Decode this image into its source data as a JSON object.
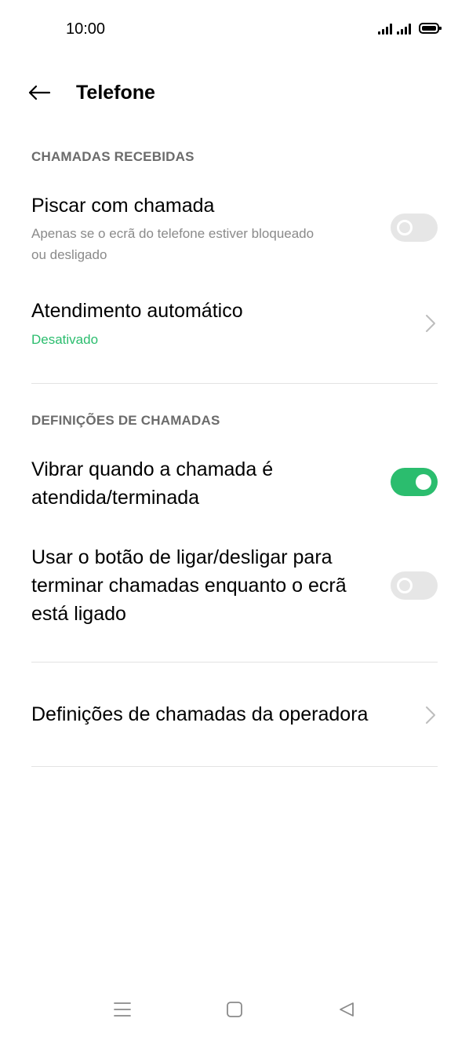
{
  "status_bar": {
    "time": "10:00",
    "signal_icons": [
      "signal-icon",
      "signal-icon"
    ],
    "battery_icon": "battery-icon"
  },
  "header": {
    "back_icon": "arrow-left-icon",
    "title": "Telefone"
  },
  "incoming_section": {
    "header": "CHAMADAS RECEBIDAS",
    "flash": {
      "title": "Piscar com chamada",
      "subtitle_line1": "Apenas se o ecrã do telefone estiver bloqueado",
      "subtitle_line2": "ou desligado",
      "toggle_on": false
    },
    "auto_answer": {
      "title": "Atendimento automático",
      "status": "Desativado",
      "chevron_icon": "chevron-right-icon"
    }
  },
  "call_settings_section": {
    "header": "DEFINIÇÕES DE CHAMADAS",
    "vibrate": {
      "title_line1": "Vibrar quando a chamada é",
      "title_line2": "atendida/terminada",
      "toggle_on": true
    },
    "power_button": {
      "title_line1": "Usar o botão de ligar/desligar para",
      "title_line2": "terminar chamadas enquanto o ecrã",
      "title_line3": "está ligado",
      "toggle_on": false
    }
  },
  "carrier_settings": {
    "title": "Definições de chamadas da operadora",
    "chevron_icon": "chevron-right-icon"
  },
  "nav_bar": {
    "menu_icon": "menu-icon",
    "home_icon": "home-square-icon",
    "back_icon": "back-triangle-icon"
  },
  "colors": {
    "accent": "#2bbd6e",
    "toggle_off": "#e6e6e6",
    "section_header": "#6b6b6b",
    "subtitle": "#8a8a8a",
    "divider": "#e3e3e3"
  }
}
